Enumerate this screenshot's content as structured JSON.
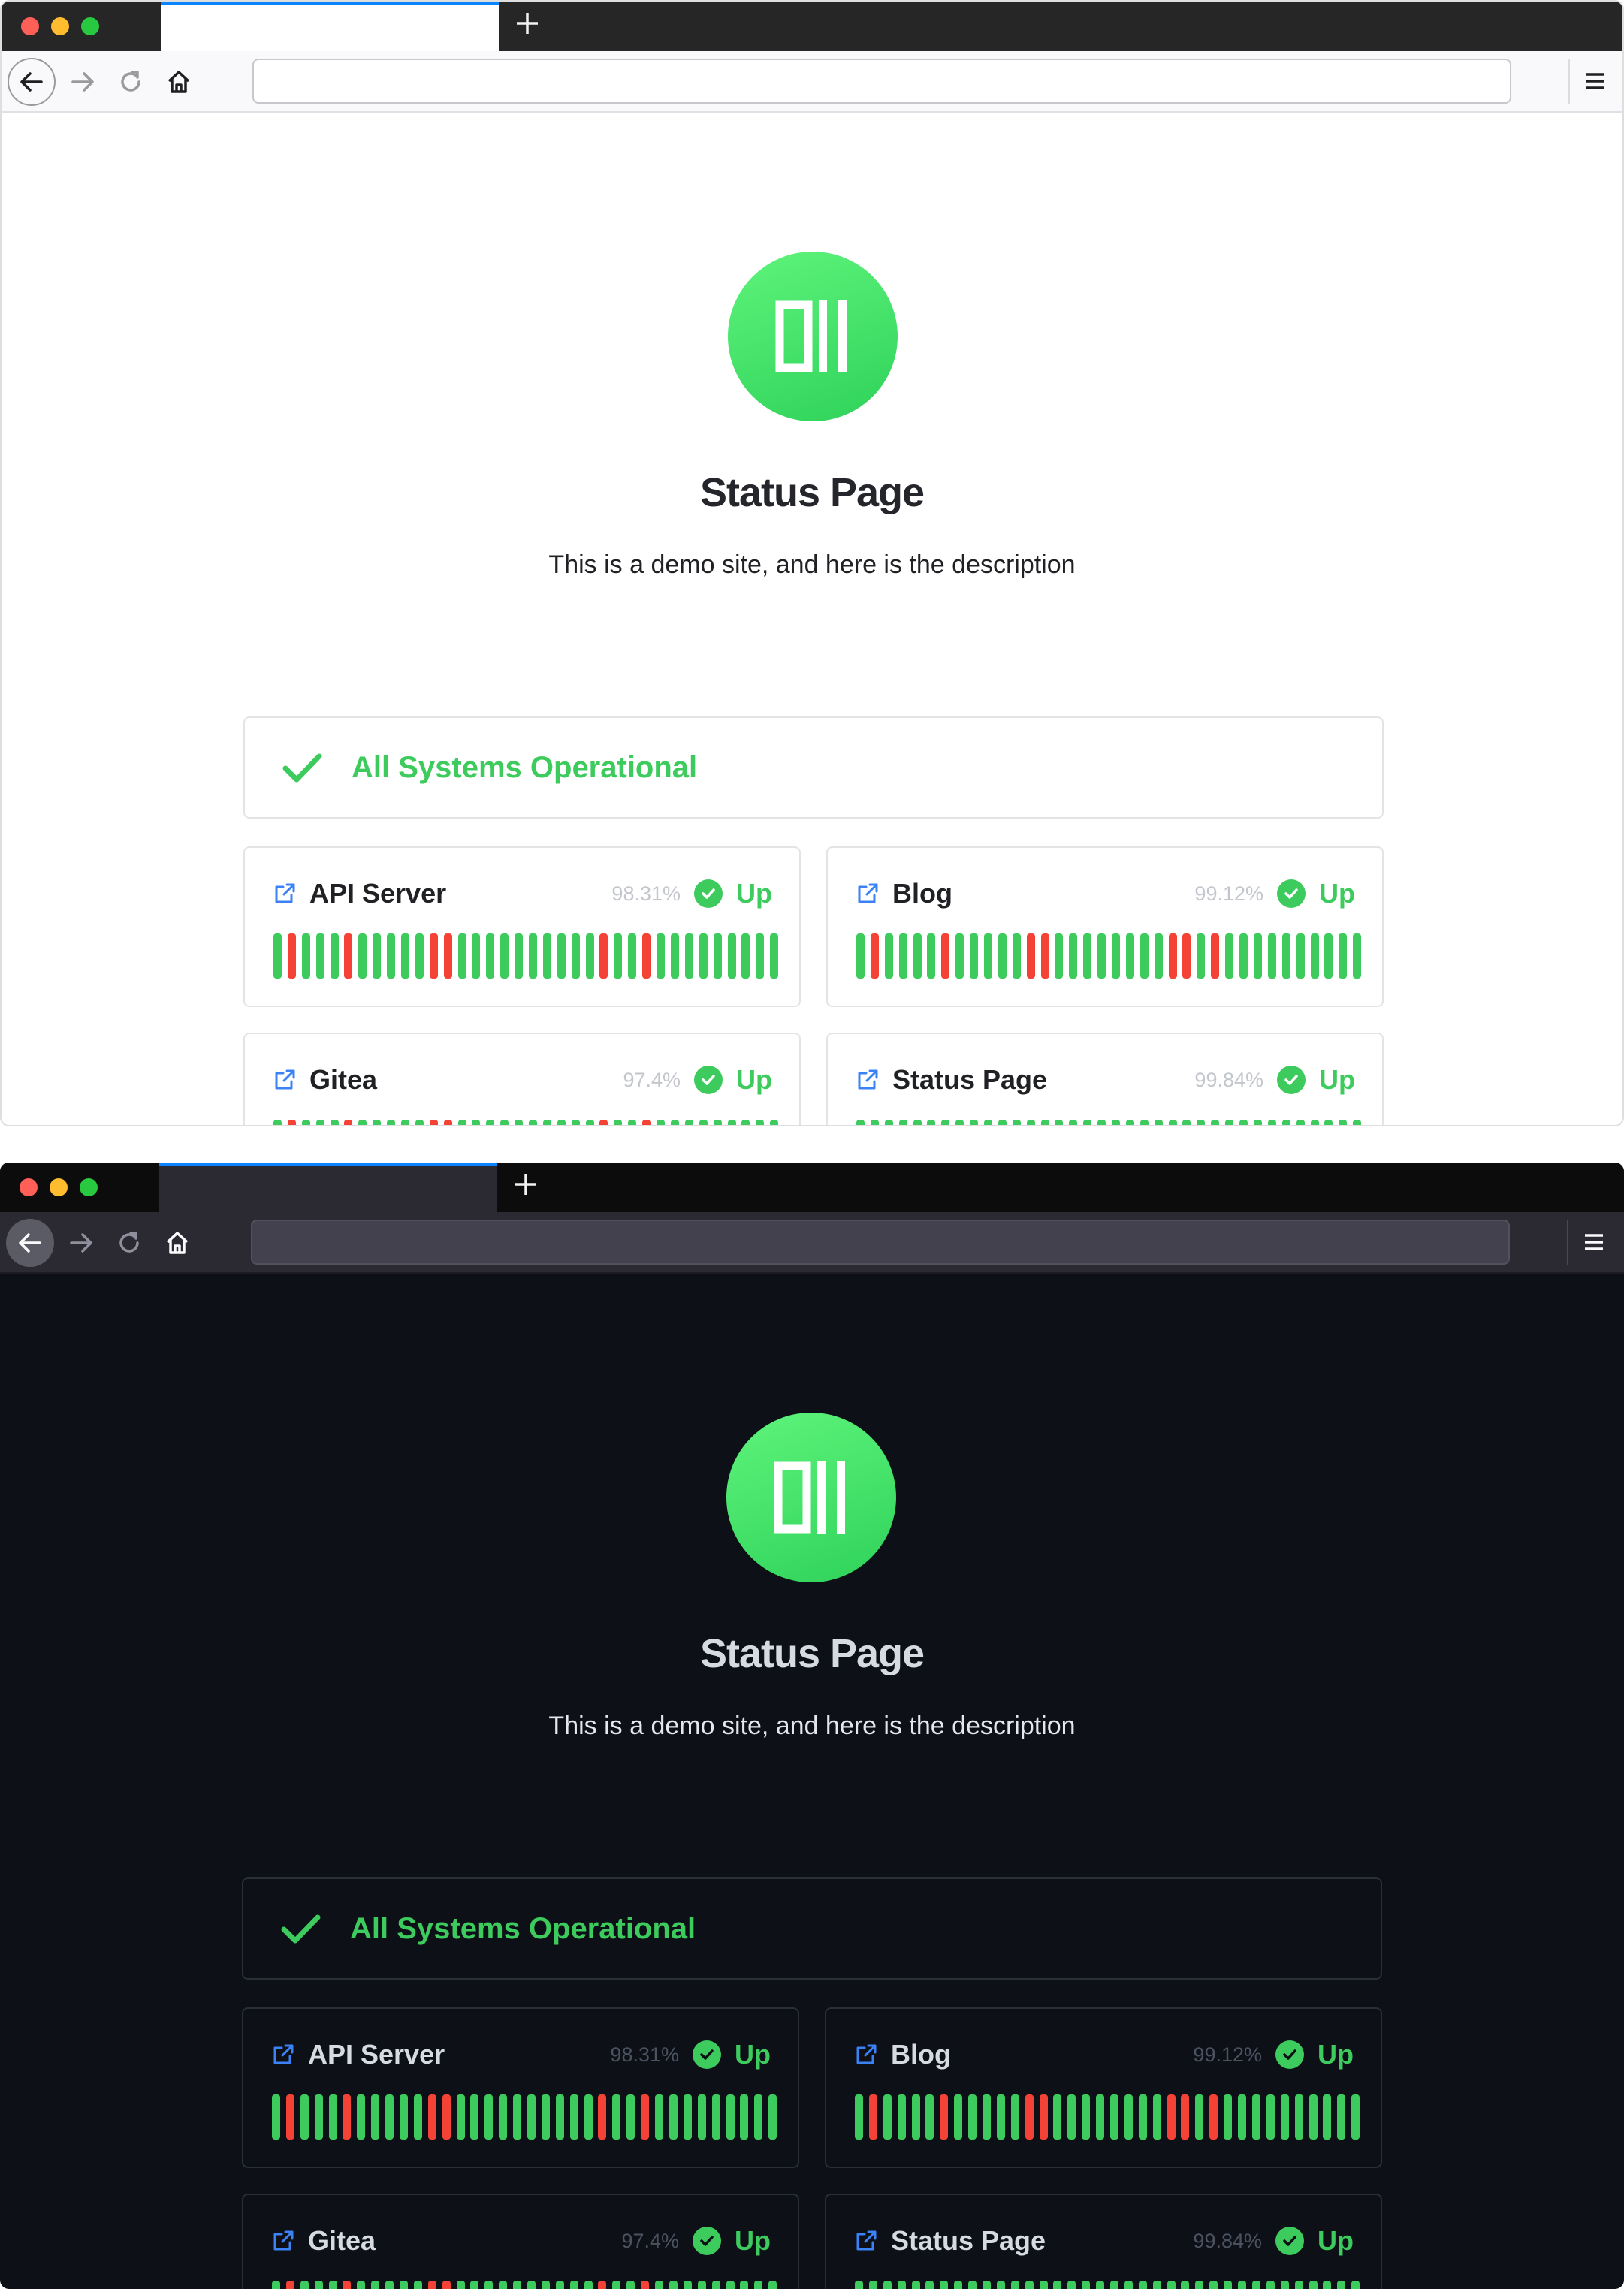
{
  "windows": [
    {
      "theme": "light",
      "page": {
        "title": "Status Page",
        "description": "This is a demo site, and here is the description",
        "overall_status": "All Systems Operational"
      },
      "monitors": [
        {
          "name": "API Server",
          "uptime": "98.31%",
          "status": "Up",
          "heartbeats": [
            1,
            0,
            1,
            1,
            1,
            0,
            1,
            1,
            1,
            1,
            1,
            0,
            0,
            1,
            1,
            1,
            1,
            1,
            1,
            1,
            1,
            1,
            1,
            0,
            1,
            1,
            0,
            1,
            1,
            1,
            1,
            1,
            1,
            1,
            1,
            1
          ]
        },
        {
          "name": "Blog",
          "uptime": "99.12%",
          "status": "Up",
          "heartbeats": [
            1,
            0,
            1,
            1,
            1,
            1,
            0,
            1,
            1,
            1,
            1,
            1,
            0,
            0,
            1,
            1,
            1,
            1,
            1,
            1,
            1,
            1,
            0,
            0,
            1,
            0,
            1,
            1,
            1,
            1,
            1,
            1,
            1,
            1,
            1,
            1
          ]
        },
        {
          "name": "Gitea",
          "uptime": "97.4%",
          "status": "Up",
          "heartbeats": [
            1,
            0,
            1,
            1,
            1,
            0,
            1,
            1,
            1,
            1,
            1,
            0,
            0,
            1,
            1,
            1,
            1,
            1,
            1,
            1,
            1,
            1,
            1,
            0,
            1,
            1,
            0,
            1,
            1,
            1,
            1,
            1,
            1,
            1,
            1,
            1
          ]
        },
        {
          "name": "Status Page",
          "uptime": "99.84%",
          "status": "Up",
          "heartbeats": [
            1,
            1,
            1,
            1,
            1,
            1,
            1,
            1,
            1,
            1,
            1,
            1,
            1,
            1,
            1,
            1,
            1,
            1,
            1,
            1,
            1,
            1,
            1,
            1,
            1,
            1,
            1,
            1,
            1,
            1,
            1,
            1,
            1,
            1,
            1,
            1
          ]
        }
      ]
    },
    {
      "theme": "dark",
      "page": {
        "title": "Status Page",
        "description": "This is a demo site, and here is the description",
        "overall_status": "All Systems Operational"
      },
      "monitors": [
        {
          "name": "API Server",
          "uptime": "98.31%",
          "status": "Up",
          "heartbeats": [
            1,
            0,
            1,
            1,
            1,
            0,
            1,
            1,
            1,
            1,
            1,
            0,
            0,
            1,
            1,
            1,
            1,
            1,
            1,
            1,
            1,
            1,
            1,
            0,
            1,
            1,
            0,
            1,
            1,
            1,
            1,
            1,
            1,
            1,
            1,
            1
          ]
        },
        {
          "name": "Blog",
          "uptime": "99.12%",
          "status": "Up",
          "heartbeats": [
            1,
            0,
            1,
            1,
            1,
            1,
            0,
            1,
            1,
            1,
            1,
            1,
            0,
            0,
            1,
            1,
            1,
            1,
            1,
            1,
            1,
            1,
            0,
            0,
            1,
            0,
            1,
            1,
            1,
            1,
            1,
            1,
            1,
            1,
            1,
            1
          ]
        },
        {
          "name": "Gitea",
          "uptime": "97.4%",
          "status": "Up",
          "heartbeats": [
            1,
            0,
            1,
            1,
            1,
            0,
            1,
            1,
            1,
            1,
            1,
            0,
            0,
            1,
            1,
            1,
            1,
            1,
            1,
            1,
            1,
            1,
            1,
            0,
            1,
            1,
            0,
            1,
            1,
            1,
            1,
            1,
            1,
            1,
            1,
            1
          ]
        },
        {
          "name": "Status Page",
          "uptime": "99.84%",
          "status": "Up",
          "heartbeats": [
            1,
            1,
            1,
            1,
            1,
            1,
            1,
            1,
            1,
            1,
            1,
            1,
            1,
            1,
            1,
            1,
            1,
            1,
            1,
            1,
            1,
            1,
            1,
            1,
            1,
            1,
            1,
            1,
            1,
            1,
            1,
            1,
            1,
            1,
            1,
            1
          ]
        }
      ]
    }
  ],
  "icons": {
    "logo": "uptime-kuma-logo-icon",
    "back": "arrow-left-icon",
    "forward": "arrow-right-icon",
    "reload": "reload-icon",
    "home": "home-icon",
    "menu": "hamburger-menu-icon",
    "overall": "checkmark-icon",
    "link": "external-link-icon",
    "status": "check-circle-icon"
  },
  "colors": {
    "up": "#3ecb5e",
    "down": "#f44336",
    "link": "#3b82f6",
    "tab_accent": "#0a84ff"
  }
}
